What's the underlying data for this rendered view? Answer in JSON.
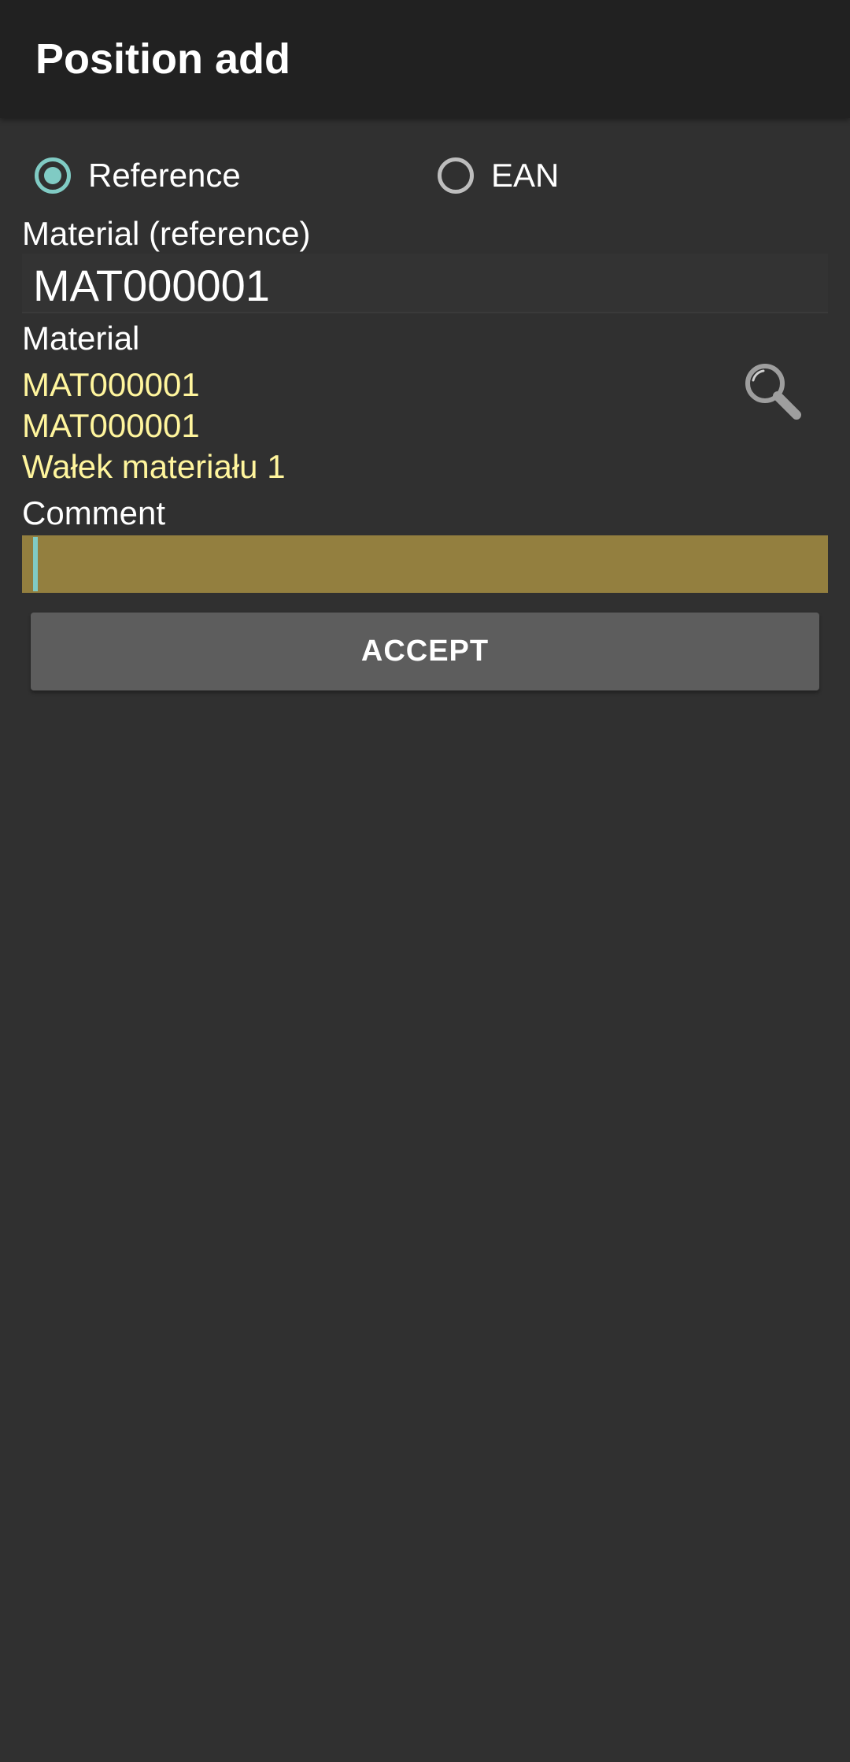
{
  "toolbar": {
    "title": "Position add"
  },
  "search_mode": {
    "options": [
      {
        "label": "Reference",
        "checked": true
      },
      {
        "label": "EAN",
        "checked": false
      }
    ]
  },
  "form": {
    "material_reference_label": "Material (reference)",
    "material_reference_value": "MAT000001",
    "material_label": "Material",
    "material_lines": [
      "MAT000001",
      "MAT000001",
      "Wałek materiału 1"
    ],
    "comment_label": "Comment",
    "comment_value": ""
  },
  "actions": {
    "accept_label": "ACCEPT"
  },
  "colors": {
    "background": "#303030",
    "toolbar": "#212121",
    "accent": "#80cbc4",
    "material_text": "#fff59d",
    "comment_field": "#937f3f",
    "button": "#5d5d5d"
  },
  "icons": {
    "search": "search-icon"
  }
}
